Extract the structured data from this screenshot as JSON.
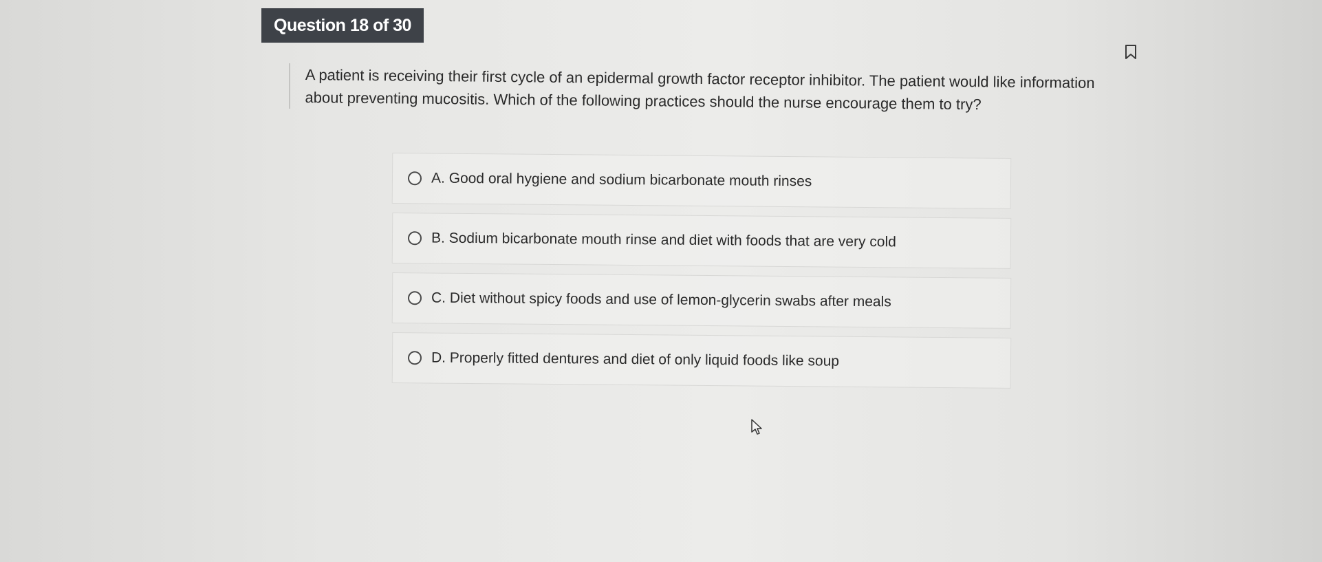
{
  "header": {
    "question_counter": "Question 18 of 30"
  },
  "question": {
    "text": "A patient is receiving their first cycle of an epidermal growth factor receptor inhibitor. The patient would like information about preventing mucositis. Which of the following practices should the nurse encourage them to try?"
  },
  "options": [
    {
      "label": "A. Good oral hygiene and sodium bicarbonate mouth rinses",
      "selected": false
    },
    {
      "label": "B. Sodium bicarbonate mouth rinse and diet with foods that are very cold",
      "selected": false
    },
    {
      "label": "C. Diet without spicy foods and use of lemon-glycerin swabs after meals",
      "selected": false
    },
    {
      "label": "D. Properly fitted dentures and diet of only liquid foods like soup",
      "selected": false
    }
  ],
  "icons": {
    "bookmark": "bookmark-icon",
    "radio": "radio-unselected-icon",
    "cursor": "mouse-pointer-icon"
  },
  "colors": {
    "badge_background": "#3e4248",
    "badge_text": "#ffffff",
    "page_background": "#e6e6e4",
    "text": "#2a2a2a"
  }
}
